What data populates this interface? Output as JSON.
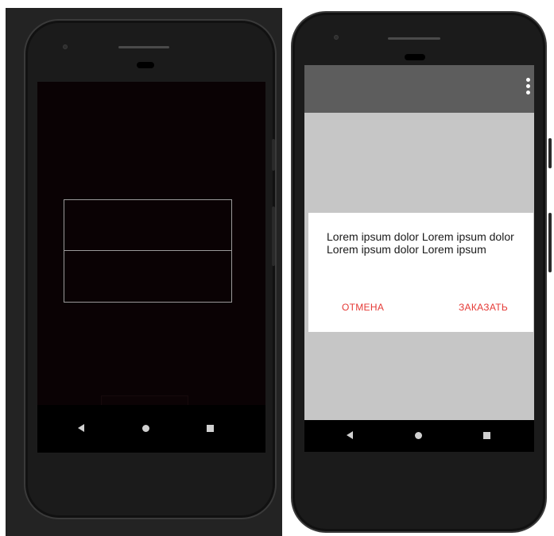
{
  "right_screen": {
    "dialog": {
      "message": "Lorem ipsum dolor Lorem ipsum dolor Lorem ipsum dolor Lorem ipsum",
      "cancel_label": "ОТМЕНА",
      "confirm_label": "ЗАКАЗАТЬ"
    }
  },
  "colors": {
    "accent": "#e53935",
    "appbar": "#5d5d5d",
    "screen_background": "#c6c6c6",
    "dark_screen_background": "#0a0204"
  },
  "icons": {
    "overflow_menu": "more-vert-icon",
    "back": "nav-back-icon",
    "home": "nav-home-icon",
    "recents": "nav-recents-icon"
  }
}
